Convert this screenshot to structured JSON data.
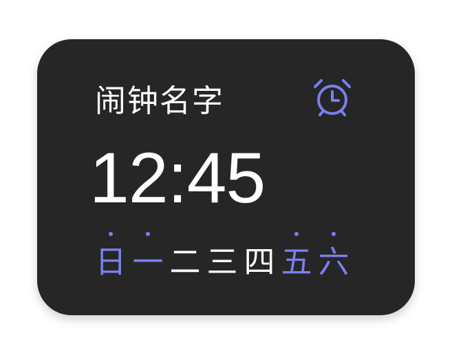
{
  "widget": {
    "alarm_name": "闹钟名字",
    "time": "12:45",
    "icon": "alarm-clock-icon",
    "accent_color": "#7b7ff0",
    "background_color": "#262626",
    "days": [
      {
        "label": "日",
        "active": true
      },
      {
        "label": "一",
        "active": true
      },
      {
        "label": "二",
        "active": false
      },
      {
        "label": "三",
        "active": false
      },
      {
        "label": "四",
        "active": false
      },
      {
        "label": "五",
        "active": true
      },
      {
        "label": "六",
        "active": true
      }
    ]
  }
}
